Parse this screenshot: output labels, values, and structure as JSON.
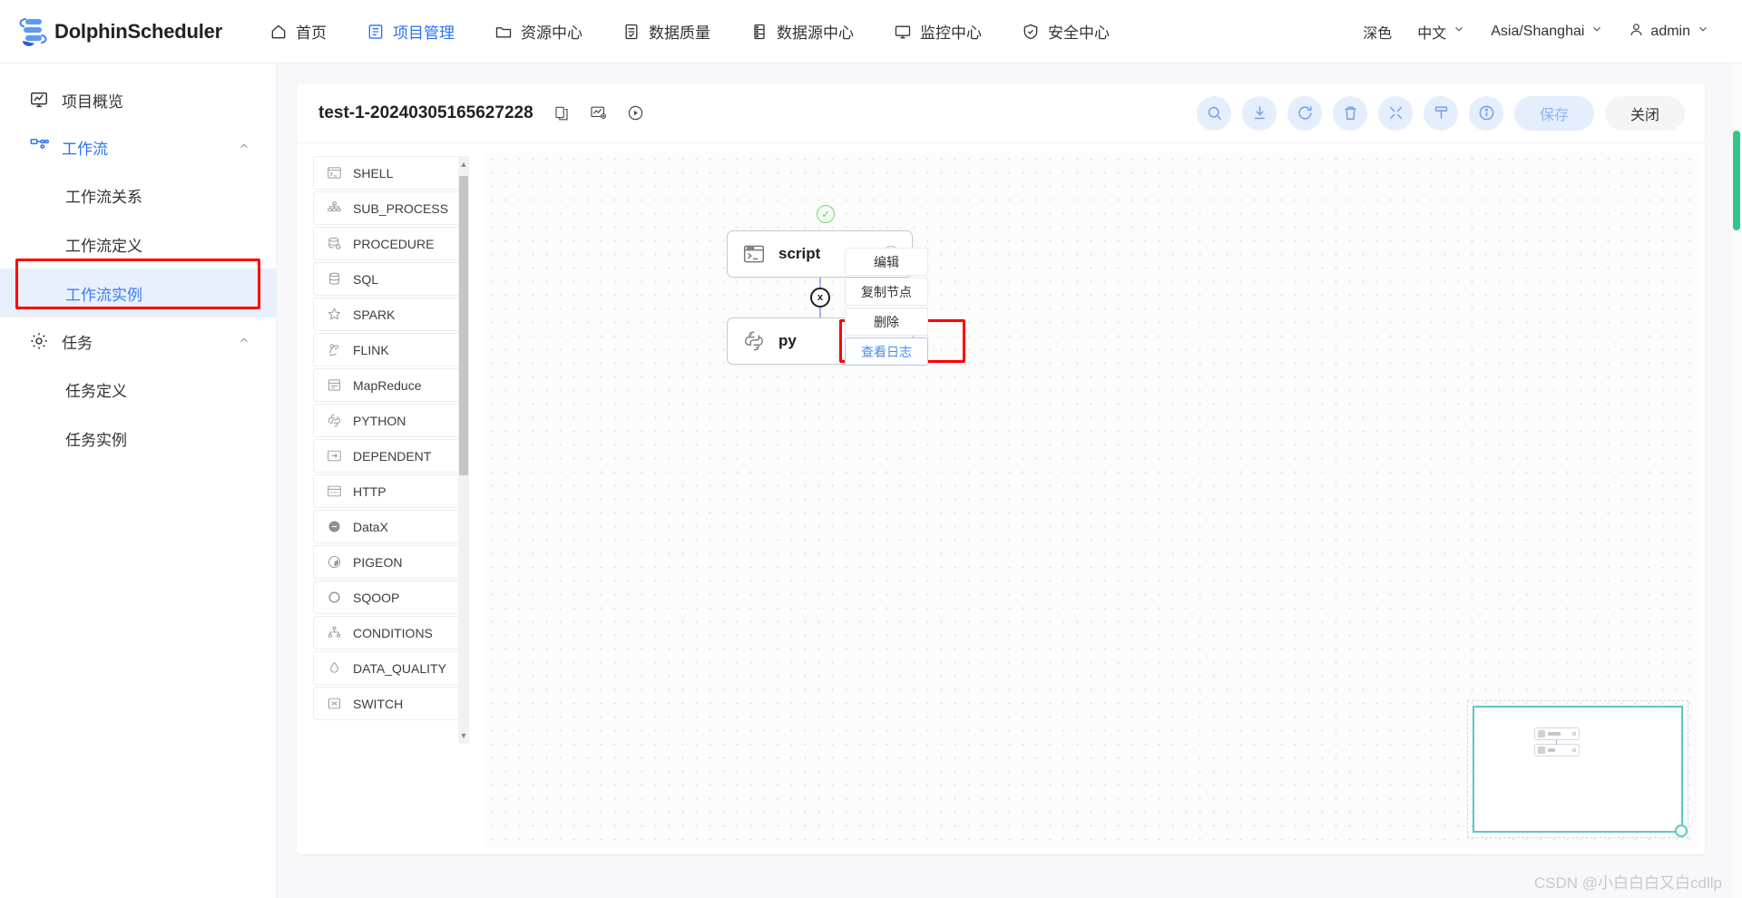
{
  "app": {
    "brand": "DolphinScheduler"
  },
  "topnav": {
    "items": [
      {
        "label": "首页",
        "icon": "home-icon",
        "active": false
      },
      {
        "label": "项目管理",
        "icon": "project-icon",
        "active": true
      },
      {
        "label": "资源中心",
        "icon": "folder-icon",
        "active": false
      },
      {
        "label": "数据质量",
        "icon": "quality-icon",
        "active": false
      },
      {
        "label": "数据源中心",
        "icon": "datasource-icon",
        "active": false
      },
      {
        "label": "监控中心",
        "icon": "monitor-icon",
        "active": false
      },
      {
        "label": "安全中心",
        "icon": "shield-icon",
        "active": false
      }
    ],
    "right": {
      "theme": "深色",
      "language": "中文",
      "timezone": "Asia/Shanghai",
      "user": "admin"
    }
  },
  "sidebar": {
    "overview": {
      "label": "项目概览",
      "icon": "overview-icon"
    },
    "workflow": {
      "label": "工作流",
      "icon": "workflow-icon",
      "children": [
        {
          "label": "工作流关系",
          "selected": false
        },
        {
          "label": "工作流定义",
          "selected": false
        },
        {
          "label": "工作流实例",
          "selected": true
        }
      ]
    },
    "task": {
      "label": "任务",
      "icon": "gear-icon",
      "children": [
        {
          "label": "任务定义",
          "selected": false
        },
        {
          "label": "任务实例",
          "selected": false
        }
      ]
    }
  },
  "toolbar": {
    "workflow_name": "test-1-20240305165627228",
    "title_icons": [
      {
        "name": "copy-icon"
      },
      {
        "name": "gantt-icon"
      },
      {
        "name": "run-icon"
      }
    ],
    "actions": [
      {
        "name": "search-icon"
      },
      {
        "name": "download-icon"
      },
      {
        "name": "refresh-icon"
      },
      {
        "name": "delete-icon"
      },
      {
        "name": "fullscreen-icon"
      },
      {
        "name": "format-icon"
      },
      {
        "name": "info-icon"
      }
    ],
    "save_label": "保存",
    "close_label": "关闭"
  },
  "task_types": [
    {
      "label": "SHELL",
      "icon": "shell-icon"
    },
    {
      "label": "SUB_PROCESS",
      "icon": "subprocess-icon"
    },
    {
      "label": "PROCEDURE",
      "icon": "procedure-icon"
    },
    {
      "label": "SQL",
      "icon": "sql-icon"
    },
    {
      "label": "SPARK",
      "icon": "spark-icon"
    },
    {
      "label": "FLINK",
      "icon": "flink-icon"
    },
    {
      "label": "MapReduce",
      "icon": "mapreduce-icon"
    },
    {
      "label": "PYTHON",
      "icon": "python-icon"
    },
    {
      "label": "DEPENDENT",
      "icon": "dependent-icon"
    },
    {
      "label": "HTTP",
      "icon": "http-icon"
    },
    {
      "label": "DataX",
      "icon": "datax-icon"
    },
    {
      "label": "PIGEON",
      "icon": "pigeon-icon"
    },
    {
      "label": "SQOOP",
      "icon": "sqoop-icon"
    },
    {
      "label": "CONDITIONS",
      "icon": "conditions-icon"
    },
    {
      "label": "DATA_QUALITY",
      "icon": "dataquality-icon"
    },
    {
      "label": "SWITCH",
      "icon": "switch-icon"
    }
  ],
  "canvas": {
    "nodes": [
      {
        "label": "script",
        "icon": "shell-icon",
        "status": "success"
      },
      {
        "label": "py",
        "icon": "python-icon",
        "status": "none"
      }
    ],
    "edge_badge": "x"
  },
  "context_menu": {
    "items": [
      {
        "label": "编辑",
        "highlight": false
      },
      {
        "label": "复制节点",
        "highlight": false
      },
      {
        "label": "删除",
        "highlight": false
      },
      {
        "label": "查看日志",
        "highlight": true
      }
    ]
  },
  "watermark": "CSDN @小白白白又白cdllp",
  "colors": {
    "accent": "#2a72f5",
    "highlight_box": "#ff0000",
    "minimap_border": "#5fc8c0",
    "status_success": "#63c463",
    "scroll_thumb": "#33c58a"
  }
}
